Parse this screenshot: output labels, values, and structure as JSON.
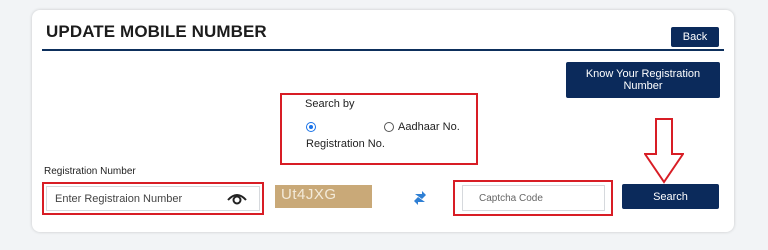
{
  "header": {
    "title": "UPDATE MOBILE NUMBER",
    "back_label": "Back"
  },
  "know_registration": {
    "label": "Know Your Registration Number"
  },
  "search_by": {
    "label": "Search by",
    "options": [
      {
        "label": "Registration No.",
        "checked": true
      },
      {
        "label": "Aadhaar No.",
        "checked": false
      }
    ]
  },
  "registration": {
    "label": "Registration Number",
    "placeholder": "Enter Registraion Number",
    "value": ""
  },
  "captcha": {
    "text": "Ut4JXG",
    "placeholder": "Captcha Code",
    "value": ""
  },
  "search_button": {
    "label": "Search"
  },
  "colors": {
    "primary": "#0b2a5b",
    "highlight": "#d81d25",
    "captcha_bg": "#c9a978",
    "refresh": "#2e7fd4"
  },
  "icons": {
    "eye": "eye-icon",
    "refresh": "refresh-icon",
    "arrow": "down-arrow-icon"
  }
}
